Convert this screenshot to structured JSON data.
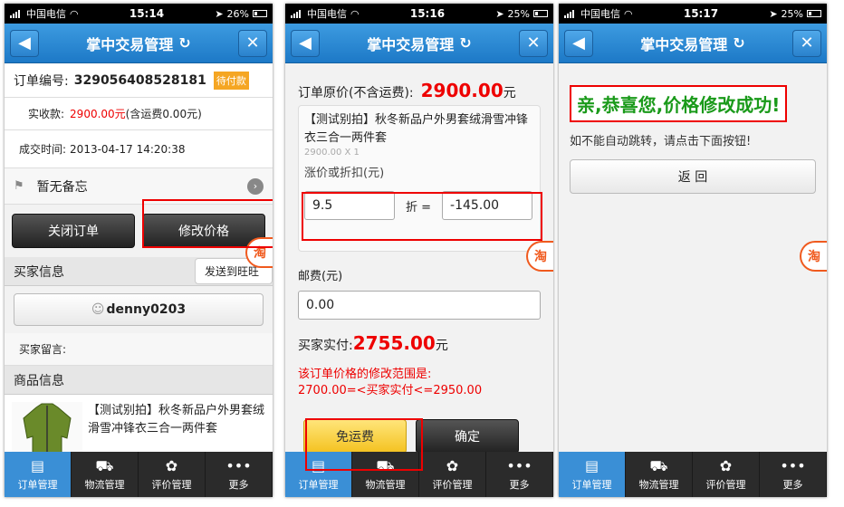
{
  "status": {
    "carrier": "中国电信",
    "screens": [
      {
        "time": "15:14",
        "battery": "26%",
        "battery_level": 0.26
      },
      {
        "time": "15:16",
        "battery": "25%",
        "battery_level": 0.25
      },
      {
        "time": "15:17",
        "battery": "25%",
        "battery_level": 0.25
      }
    ]
  },
  "nav": {
    "title": "掌中交易管理",
    "back_glyph": "◀",
    "close_glyph": "✕",
    "refresh_glyph": "↻"
  },
  "tabs": [
    {
      "label": "订单管理",
      "icon": "clipboard-icon",
      "glyph": "▤"
    },
    {
      "label": "物流管理",
      "icon": "truck-icon",
      "glyph": "⛟"
    },
    {
      "label": "评价管理",
      "icon": "flower-icon",
      "glyph": "✿"
    },
    {
      "label": "更多",
      "icon": "more-icon",
      "glyph": "•••"
    }
  ],
  "float_badge": "淘",
  "screen1": {
    "order_no_label": "订单编号:",
    "order_no": "329056408528181",
    "status_badge": "待付款",
    "paid_label": "实收款:",
    "paid_amount": "2900.00元",
    "paid_note": "(含运费0.00元)",
    "deal_time_label": "成交时间:",
    "deal_time": "2013-04-17 14:20:38",
    "memo": "暂无备忘",
    "close_order": "关闭订单",
    "modify_price": "修改价格",
    "buyer_section": "买家信息",
    "send_to_wangwang": "发送到旺旺",
    "buyer_name": "denny0203",
    "buyer_message_label": "买家留言:",
    "goods_section": "商品信息",
    "goods_title": "【测试别拍】秋冬新品户外男套绒滑雪冲锋衣三合一两件套"
  },
  "screen2": {
    "orig_price_label": "订单原价(不含运费):",
    "orig_price": "2900.00",
    "orig_price_unit": "元",
    "item_title": "【测试别拍】秋冬新品户外男套绒滑雪冲锋衣三合一两件套",
    "item_qty": "2900.00 X 1",
    "discount_label": "涨价或折扣(元)",
    "discount_rate": "9.5",
    "discount_rate_unit": "折 =",
    "discount_amount": "-145.00",
    "postage_label": "邮费(元)",
    "postage_value": "0.00",
    "actual_label": "买家实付:",
    "actual_value": "2755.00",
    "actual_unit": "元",
    "range_line1": "该订单价格的修改范围是:",
    "range_line2": "2700.00=<买家实付<=2950.00",
    "free_shipping": "免运费",
    "confirm": "确定"
  },
  "screen3": {
    "success_msg": "亲,恭喜您,价格修改成功!",
    "hint": "如不能自动跳转，请点击下面按钮!",
    "back_button": "返 回"
  }
}
